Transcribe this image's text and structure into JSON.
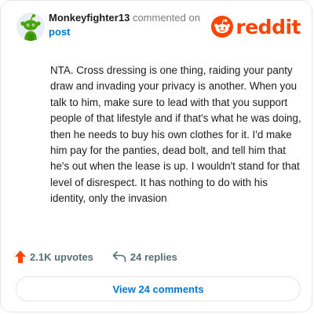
{
  "comment": {
    "username": "Monkeyfighter13",
    "action_text": "commented on",
    "target_link": "post",
    "body": "NTA. Cross dressing is one thing, raiding your panty draw and invading your privacy is another. When you talk to him, make sure to lead with that you support people of that lifestyle and if that's what he was doing, then he needs to buy his own clothes for it. I'd make him pay for the panties, dead bolt, and tell him that he's out when the lease is up. I wouldn't stand for that level of disrespect. It has nothing to do with his identity, only the invasion"
  },
  "brand": {
    "wordmark": "reddit",
    "icon": "reddit-snoo-icon",
    "color": "#ff4500"
  },
  "stats": {
    "upvotes_label": "2.1K upvotes",
    "upvote_icon": "upvote-arrow-icon",
    "replies_label": "24 replies",
    "replies_icon": "reply-arrow-icon"
  },
  "view_comments": {
    "label": "View 24 comments"
  },
  "avatar": {
    "icon": "snoo-avatar-icon",
    "color": "#46a508"
  },
  "colors": {
    "link": "#0079d3",
    "muted": "#7c7c7c",
    "action_gray": "#576f76",
    "border": "#e4e6e8"
  }
}
